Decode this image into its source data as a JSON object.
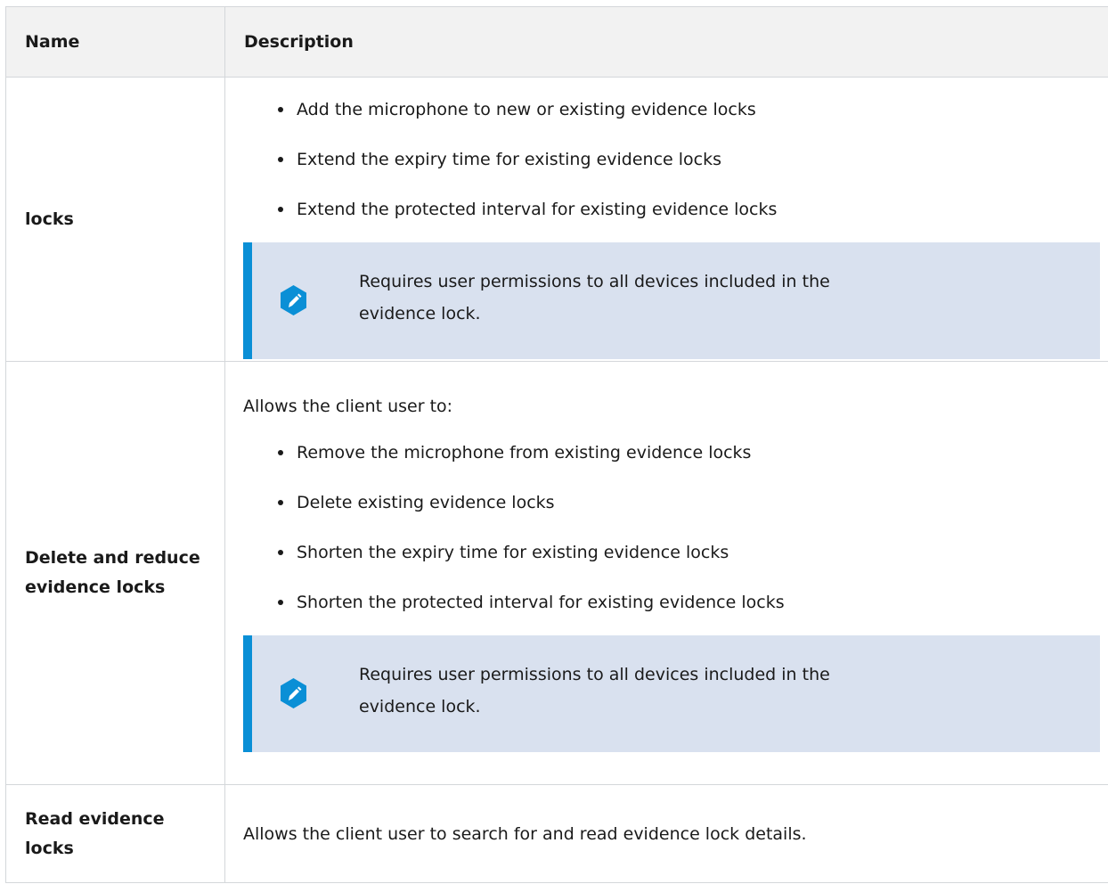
{
  "table": {
    "header": {
      "name": "Name",
      "description": "Description"
    },
    "rows": [
      {
        "name": "locks",
        "intro": "",
        "bullets": [
          "Add the microphone to new or existing evidence locks",
          "Extend the expiry time for existing evidence locks",
          "Extend the protected interval for existing evidence locks"
        ],
        "note": "Requires user permissions to all devices included in the evidence lock."
      },
      {
        "name": "Delete and reduce evidence locks",
        "intro": "Allows the client user to:",
        "bullets": [
          "Remove the microphone from existing evidence locks",
          "Delete existing evidence locks",
          "Shorten the expiry time for existing evidence locks",
          "Shorten the protected interval for existing evidence locks"
        ],
        "note": "Requires user permissions to all devices included in the evidence lock."
      },
      {
        "name": "Read evidence locks",
        "intro": "Allows the client user to search for and read evidence lock details."
      }
    ]
  },
  "icons": {
    "note": "edit-pencil-icon"
  },
  "colors": {
    "header_bg": "#f2f2f2",
    "note_bg": "#d9e1ef",
    "note_accent": "#0a8fd6",
    "border": "#d4d7da"
  }
}
